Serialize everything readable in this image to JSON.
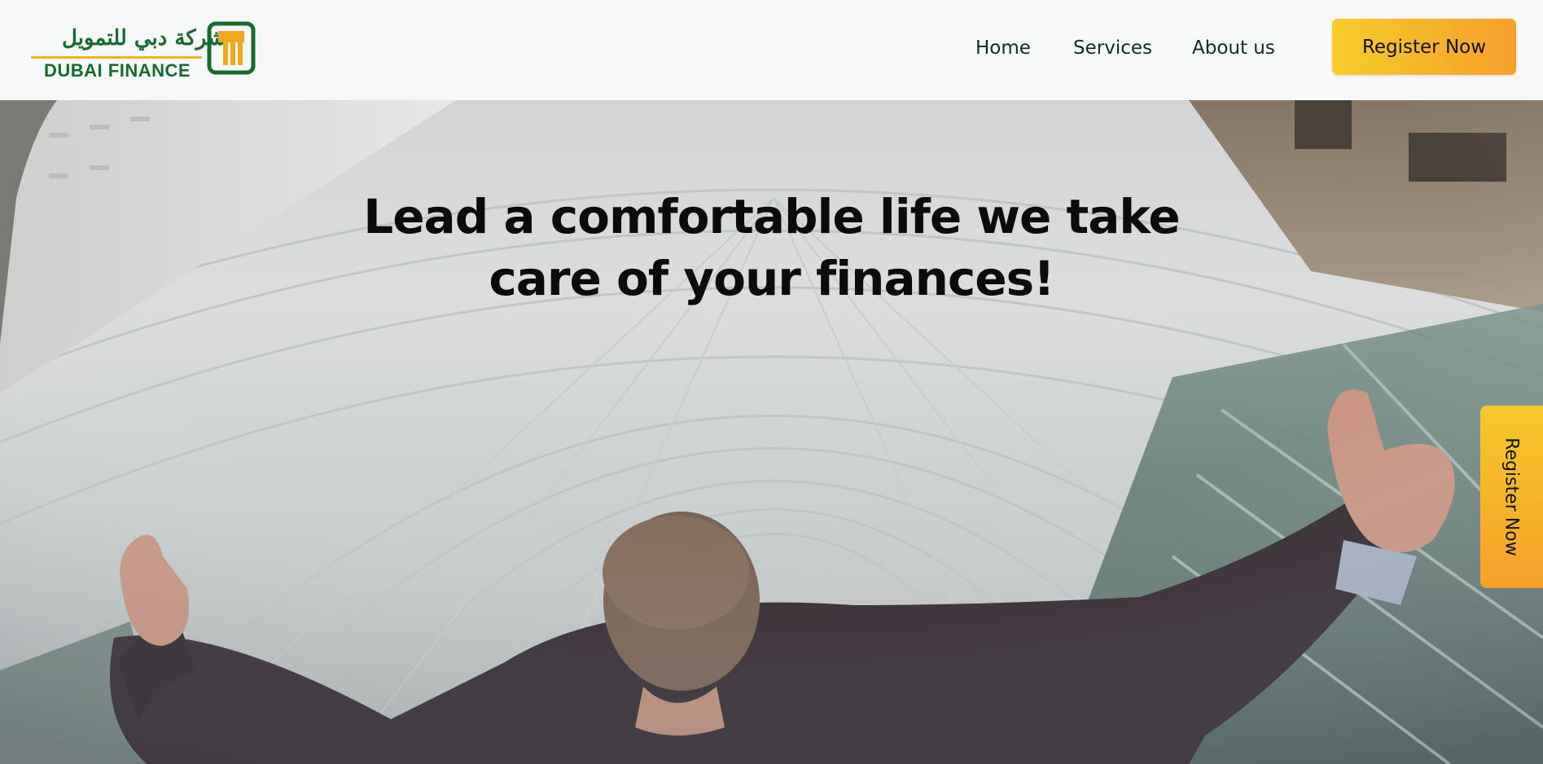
{
  "header": {
    "logo": {
      "arabic_text": "شركة دبي للتمويل",
      "english_text": "DUBAI FINANCE",
      "icon": "dubai-finance-logo-mark"
    },
    "nav": [
      {
        "label": "Home"
      },
      {
        "label": "Services"
      },
      {
        "label": "About us"
      }
    ],
    "register_label": "Register Now"
  },
  "hero": {
    "title_line1": "Lead a comfortable life we take",
    "title_line2": "care of your finances!",
    "side_register_label": "Register Now"
  },
  "colors": {
    "brand_green": "#1a6a2f",
    "accent_yellow": "#f7cc2b",
    "accent_orange": "#f5a02a",
    "nav_text": "#0f2d1f"
  }
}
